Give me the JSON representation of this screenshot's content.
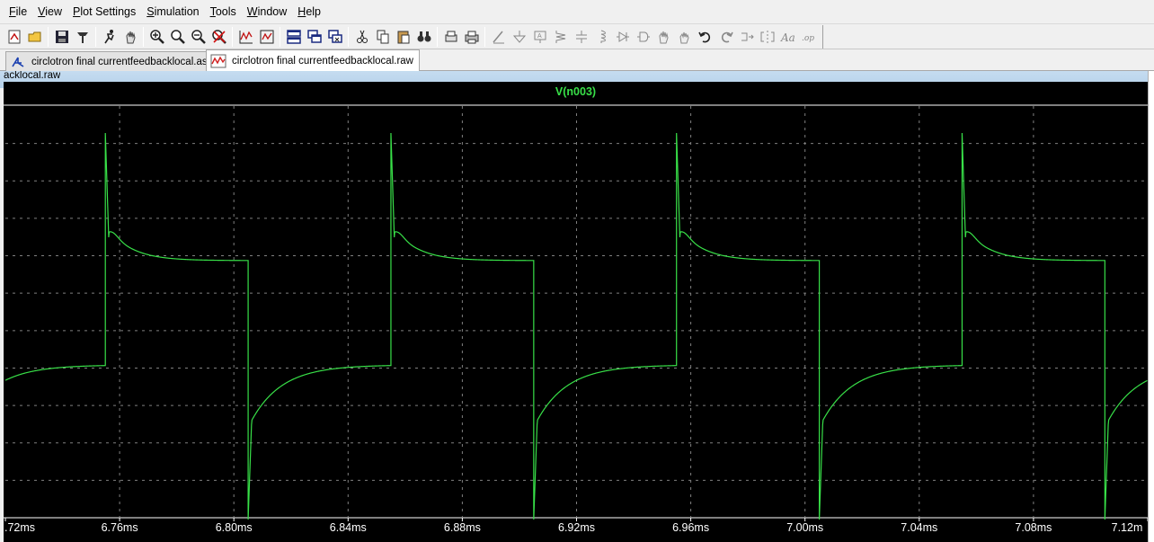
{
  "menu": {
    "items": [
      {
        "label": "File",
        "key": "F",
        "rest": "ile"
      },
      {
        "label": "View",
        "key": "V",
        "rest": "iew"
      },
      {
        "label": "Plot Settings",
        "key": "P",
        "rest": "lot Settings"
      },
      {
        "label": "Simulation",
        "key": "S",
        "rest": "imulation"
      },
      {
        "label": "Tools",
        "key": "T",
        "rest": "ools"
      },
      {
        "label": "Window",
        "key": "W",
        "rest": "indow"
      },
      {
        "label": "Help",
        "key": "H",
        "rest": "elp"
      }
    ]
  },
  "toolbar": {
    "icons": [
      "new-schematic-icon",
      "open-icon",
      "save-icon",
      "control-panel-icon",
      "run-icon",
      "halt-icon",
      "zoom-in-icon",
      "zoom-area-icon",
      "zoom-out-icon",
      "zoom-cancel-icon",
      "autorange-icon",
      "fit-icon",
      "tile-icon",
      "cascade-icon",
      "close-window-icon",
      "cut-icon",
      "copy-icon",
      "paste-icon",
      "find-icon",
      "print-preview-icon",
      "print-icon",
      "wire-icon",
      "ground-icon",
      "label-icon",
      "resistor-icon",
      "capacitor-icon",
      "inductor-icon",
      "diode-icon",
      "component-icon",
      "move-icon",
      "drag-icon",
      "undo-icon",
      "redo-icon",
      "rotate-icon",
      "mirror-icon",
      "text-icon",
      "spice-directive-icon"
    ]
  },
  "tabs": [
    {
      "label": "circlotron final currentfeedbacklocal.asc",
      "active": false,
      "icon": "schematic-icon"
    },
    {
      "label": "circlotron final currentfeedbacklocal.raw",
      "active": true,
      "icon": "waveform-icon"
    }
  ],
  "window": {
    "title": "acklocal.raw"
  },
  "colors": {
    "trace": "#38e048",
    "background": "#000000",
    "grid": "#808080",
    "axis_text": "#ffffff"
  },
  "chart_data": {
    "type": "line",
    "title": "V(n003)",
    "series": [
      {
        "name": "V(n003)"
      }
    ],
    "xlabel": "",
    "ylabel": "",
    "xlim": [
      6.72,
      7.12
    ],
    "x_unit": "ms",
    "x_tick_labels": [
      ".72ms",
      "6.76ms",
      "6.80ms",
      "6.84ms",
      "6.88ms",
      "6.92ms",
      "6.96ms",
      "7.00ms",
      "7.04ms",
      "7.08ms",
      "7.12m"
    ],
    "x_ticks": [
      6.72,
      6.76,
      6.8,
      6.84,
      6.88,
      6.92,
      6.96,
      7.0,
      7.04,
      7.08,
      7.12
    ],
    "ylim": [
      0,
      1
    ],
    "y_tick_labels_visible": false,
    "grid": true,
    "waveform": {
      "shape": "square-with-overshoot",
      "period_ms": 0.1,
      "rise_times_ms": [
        6.755,
        6.855,
        6.955,
        7.055
      ],
      "fall_times_ms": [
        6.805,
        6.905,
        7.005,
        7.105
      ],
      "high_level": 0.34,
      "low_level": -0.32,
      "overshoot_peak": 1.0,
      "undershoot_peak": -1.0
    }
  }
}
